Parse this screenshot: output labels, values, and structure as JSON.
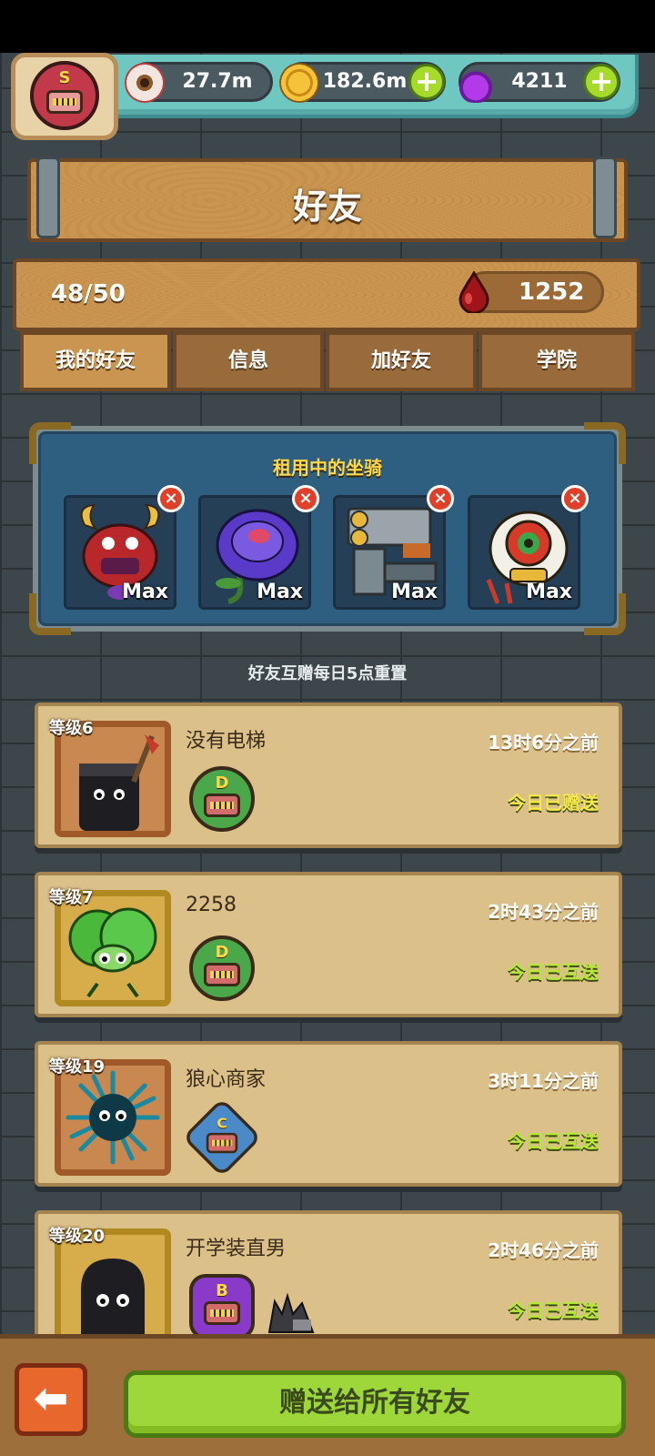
{
  "header": {
    "rank_letter": "S",
    "resources": [
      {
        "icon": "eyeball-icon",
        "value": "27.7m"
      },
      {
        "icon": "gold-coin-icon",
        "value": "182.6m"
      },
      {
        "icon": "potion-icon",
        "value": "4211"
      }
    ]
  },
  "page": {
    "title": "好友",
    "friend_count": "48/50",
    "blood_count": "1252"
  },
  "tabs": [
    {
      "label": "我的好友",
      "active": true
    },
    {
      "label": "信息",
      "active": false
    },
    {
      "label": "加好友",
      "active": false
    },
    {
      "label": "学院",
      "active": false
    }
  ],
  "mounts": {
    "title": "租用中的坐骑",
    "items": [
      {
        "name": "red-horned-demon",
        "level": "Max"
      },
      {
        "name": "purple-rose",
        "level": "Max"
      },
      {
        "name": "machine-fortress",
        "level": "Max"
      },
      {
        "name": "lion-dance",
        "level": "Max"
      }
    ]
  },
  "reset_note": "好友互赠每日5点重置",
  "friends": [
    {
      "level": "等级6",
      "name": "没有电梯",
      "time": "13时6分之前",
      "status": "今日已赠送",
      "status_color": "#f6e94a",
      "rank": "D",
      "avatar": "black-blob-with-axe"
    },
    {
      "level": "等级7",
      "name": "2258",
      "time": "2时43分之前",
      "status": "今日已互送",
      "status_color": "#b6e83a",
      "rank": "D",
      "avatar": "lettuce-monster"
    },
    {
      "level": "等级19",
      "name": "狼心商家",
      "time": "3时11分之前",
      "status": "今日已互送",
      "status_color": "#b6e83a",
      "rank": "C",
      "avatar": "blue-spiky-ball"
    },
    {
      "level": "等级20",
      "name": "开学装直男",
      "time": "2时46分之前",
      "status": "今日已互送",
      "status_color": "#b6e83a",
      "rank": "B",
      "avatar": "black-blob"
    }
  ],
  "bottom": {
    "gift_all_label": "赠送给所有好友"
  },
  "colors": {
    "wood": "#c99550",
    "panel_blue": "#2f5f80",
    "green_button": "#9ed73a",
    "back_button": "#e8672c"
  }
}
